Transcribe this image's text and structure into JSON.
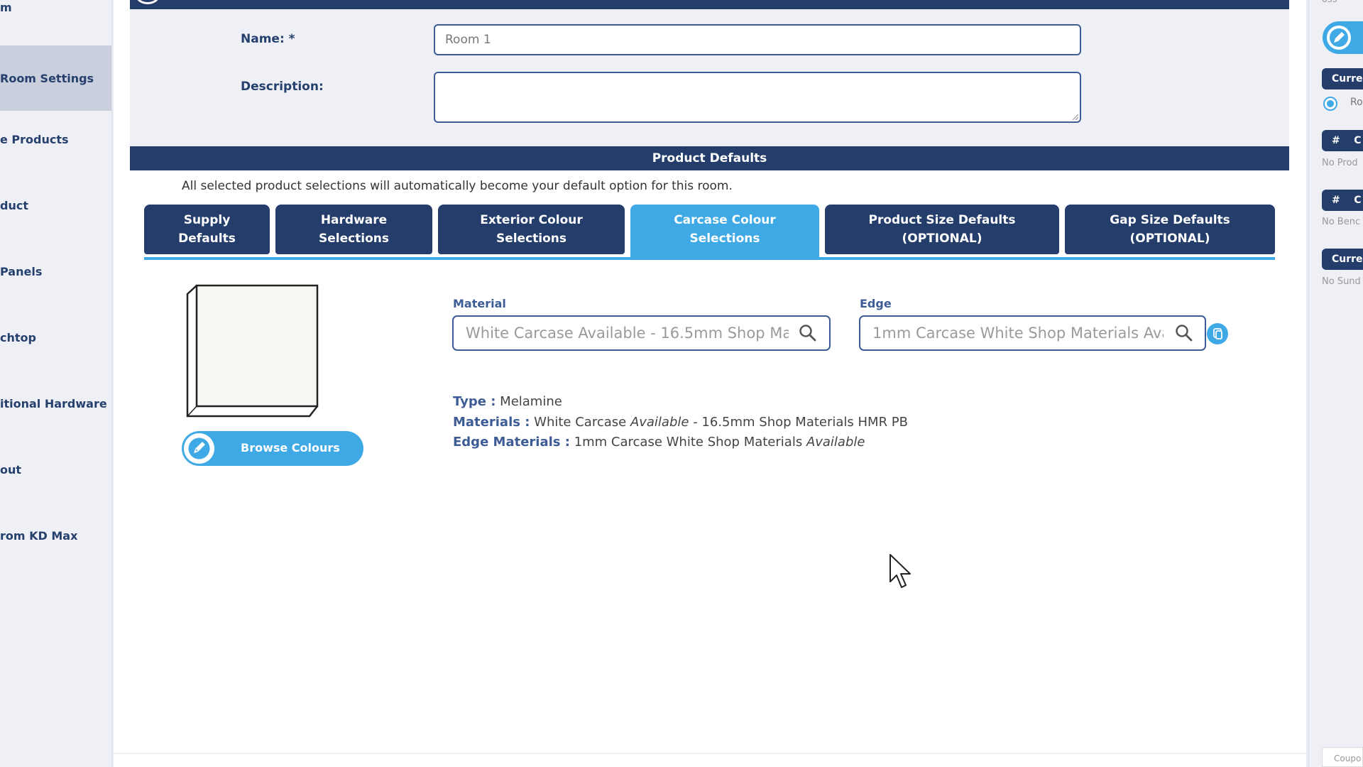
{
  "sidebar": {
    "items": [
      {
        "label": "m"
      },
      {
        "label": "Room Settings"
      },
      {
        "label": "e Products"
      },
      {
        "label": "duct"
      },
      {
        "label": "Panels"
      },
      {
        "label": "chtop"
      },
      {
        "label": "itional Hardware"
      },
      {
        "label": "out"
      },
      {
        "label": "rom KD Max"
      }
    ]
  },
  "form": {
    "name_label": "Name: *",
    "name_value": "Room 1",
    "description_label": "Description:",
    "description_value": ""
  },
  "product_defaults": {
    "header": "Product Defaults",
    "note": "All selected product selections will automatically become your default option for this room.",
    "tabs": [
      {
        "line1": "Supply",
        "line2": "Defaults"
      },
      {
        "line1": "Hardware",
        "line2": "Selections"
      },
      {
        "line1": "Exterior Colour",
        "line2": "Selections"
      },
      {
        "line1": "Carcase Colour",
        "line2": "Selections"
      },
      {
        "line1": "Product Size Defaults",
        "line2": "(OPTIONAL)"
      },
      {
        "line1": "Gap Size Defaults",
        "line2": "(OPTIONAL)"
      }
    ],
    "active_tab": "Carcase Colour Selections"
  },
  "carcase": {
    "browse_label": "Browse Colours",
    "material_label": "Material",
    "material_value": "White Carcase Available - 16.5mm Shop Materials HMR PB",
    "edge_label": "Edge",
    "edge_value": "1mm Carcase White Shop Materials Available",
    "type_label": "Type :",
    "type_value": "Melamine",
    "materials_label": "Materials :",
    "materials_value_1": "White Carcase",
    "materials_value_2": "Available",
    "materials_value_3": "- 16.5mm Shop Materials HMR PB",
    "edge_materials_label": "Edge Materials :",
    "edge_materials_value_1": "1mm Carcase White Shop Materials",
    "edge_materials_value_2": "Available"
  },
  "right_panel": {
    "top_label": "oss",
    "current_1": "Curre",
    "radio_label": "Ro",
    "hash_1": "#",
    "hash_1_letter": "C",
    "no_products": "No Prod",
    "hash_2": "#",
    "hash_2_letter": "C",
    "no_bench": "No Benc",
    "current_2": "Curre",
    "no_sundries": "No Sund",
    "coupon": "Coupo"
  },
  "colors": {
    "navy": "#243d6b",
    "accent": "#3fa9e6",
    "panel": "#eef0f5"
  }
}
